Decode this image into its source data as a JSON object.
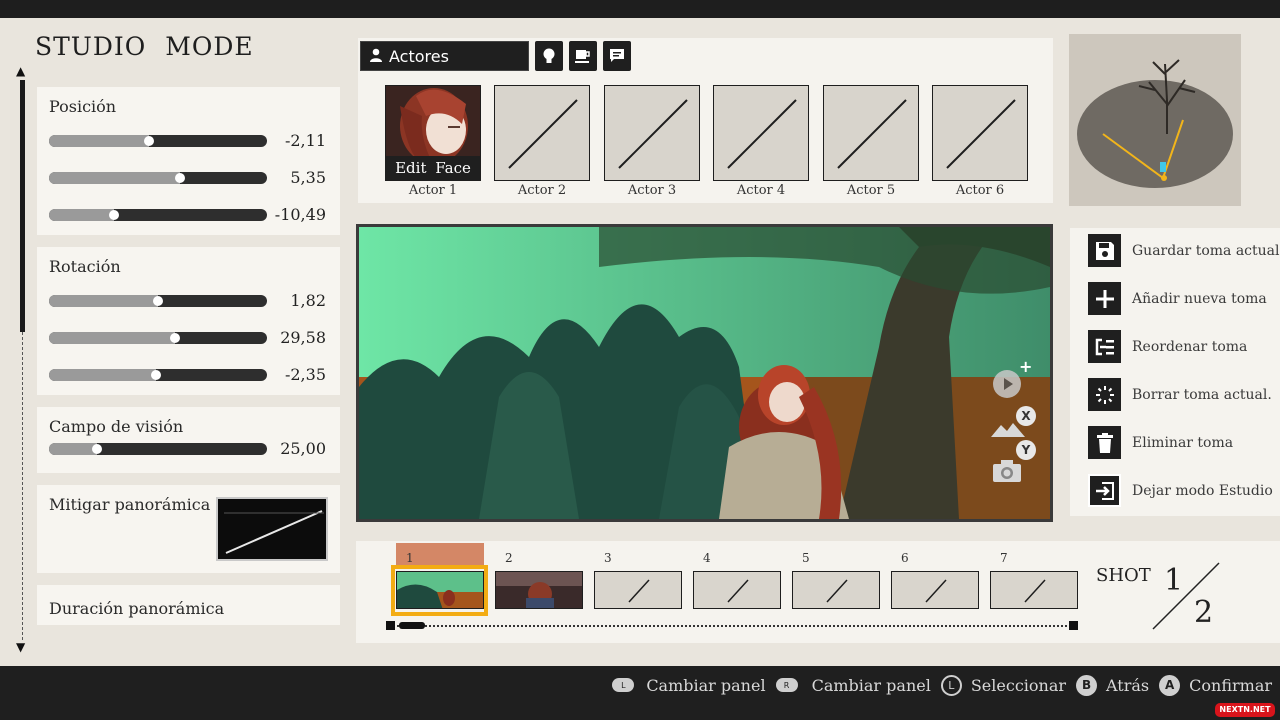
{
  "title": "STUDIO MODE",
  "left_panel": {
    "position": {
      "label": "Posición",
      "sliders": [
        {
          "value": "-2,11",
          "fraction": 0.46
        },
        {
          "value": "5,35",
          "fraction": 0.6
        },
        {
          "value": "-10,49",
          "fraction": 0.3
        }
      ]
    },
    "rotation": {
      "label": "Rotación",
      "sliders": [
        {
          "value": "1,82",
          "fraction": 0.5
        },
        {
          "value": "29,58",
          "fraction": 0.58
        },
        {
          "value": "-2,35",
          "fraction": 0.49
        }
      ]
    },
    "fov": {
      "label": "Campo de visión",
      "sliders": [
        {
          "value": "25,00",
          "fraction": 0.22
        }
      ]
    },
    "mitigar_label": "Mitigar panorámica",
    "duracion_label": "Duración panorámica"
  },
  "actors": {
    "dropdown_label": "Actores",
    "edit_face": "Edit Face",
    "slots": [
      "Actor 1",
      "Actor 2",
      "Actor 3",
      "Actor 4",
      "Actor 5",
      "Actor 6"
    ]
  },
  "actions": [
    {
      "icon": "save-icon",
      "label": "Guardar toma actual."
    },
    {
      "icon": "plus-icon",
      "label": "Añadir nueva toma"
    },
    {
      "icon": "reorder-icon",
      "label": "Reordenar toma"
    },
    {
      "icon": "sparkle-icon",
      "label": "Borrar toma actual."
    },
    {
      "icon": "trash-icon",
      "label": "Eliminar toma"
    },
    {
      "icon": "exit-icon",
      "label": "Dejar modo Estudio"
    }
  ],
  "viewport_buttons": {
    "x": "X",
    "y": "Y"
  },
  "timeline": {
    "shots": [
      "1",
      "2",
      "3",
      "4",
      "5",
      "6",
      "7"
    ],
    "selected": 1,
    "shot_label": "SHOT",
    "current": "1",
    "total": "2"
  },
  "hints": [
    {
      "button": "L",
      "label": "Cambiar panel"
    },
    {
      "button": "R",
      "label": "Cambiar panel"
    },
    {
      "button": "L",
      "label": "Seleccionar"
    },
    {
      "button": "B",
      "label": "Atrás"
    },
    {
      "button": "A",
      "label": "Confirmar"
    }
  ],
  "watermark": "NEXTN.NET",
  "colors": {
    "selection": "#f3ac14",
    "selected_tab": "#d48766",
    "panel_dark": "#1f1f1f"
  }
}
